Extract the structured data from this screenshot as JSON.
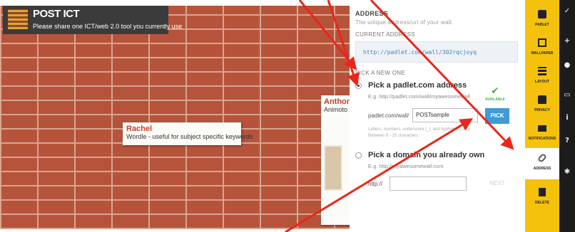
{
  "wall": {
    "title": "POST ICT",
    "description": "Please share one ICT/web 2.0 tool you currently use",
    "posts": [
      {
        "author": "Rachel",
        "body": "Wordle - useful for subject specific keywords"
      },
      {
        "author": "Anthony",
        "body": "Animoto"
      }
    ]
  },
  "panel": {
    "heading": "ADDRESS",
    "subheading": "The unique address/url of your wall.",
    "current_label": "CURRENT ADDRESS",
    "current_url": "http://padlet.com/wall/302rqcjoyq",
    "pick_new_label": "PICK A NEW ONE",
    "option1": {
      "title": "Pick a padlet.com address",
      "example": "E.g. http://padlet.com/wall/myawesomewall",
      "prefix": "padlet.com/wall/",
      "value": "POSTsample",
      "status": "AVAILABLE",
      "button": "PICK",
      "help1": "Letters, numbers, underscore (_), and hyphen (-) only.",
      "help2": "Between 8 - 25 characters."
    },
    "option2": {
      "title": "Pick a domain you already own",
      "example": "E.g. http://myawesomewall.com",
      "prefix": "http://",
      "value": "",
      "button": "NEXT"
    }
  },
  "sidebar": {
    "items": [
      {
        "label": "PADLET",
        "icon": "padlet-icon"
      },
      {
        "label": "WALLPAPER",
        "icon": "wallpaper-icon"
      },
      {
        "label": "LAYOUT",
        "icon": "layout-icon"
      },
      {
        "label": "PRIVACY",
        "icon": "lock-icon"
      },
      {
        "label": "NOTIFICATIONS",
        "icon": "envelope-icon"
      },
      {
        "label": "ADDRESS",
        "icon": "link-icon"
      },
      {
        "label": "DELETE",
        "icon": "trash-icon"
      }
    ]
  },
  "darkbar": {
    "icons": [
      "chevron-icon",
      "plus-icon",
      "user-icon",
      "share-icon",
      "info-icon",
      "help-icon",
      "gear-icon"
    ]
  },
  "colors": {
    "sidebar": "#f4c20d",
    "brick": "#b5543a",
    "accent": "#3d9bd8",
    "available": "#4cae4c",
    "arrow": "#e8261c"
  }
}
